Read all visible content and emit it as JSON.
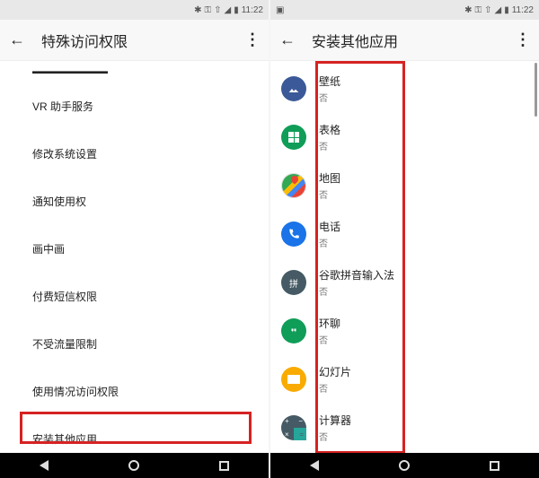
{
  "status": {
    "clock": "11:22"
  },
  "left": {
    "title": "特殊访问权限",
    "items": [
      "VR 助手服务",
      "修改系统设置",
      "通知使用权",
      "画中画",
      "付费短信权限",
      "不受流量限制",
      "使用情况访问权限",
      "安装其他应用"
    ]
  },
  "right": {
    "title": "安装其他应用",
    "deny_label": "否",
    "apps": [
      {
        "name": "壁纸",
        "icon": "photos"
      },
      {
        "name": "表格",
        "icon": "sheets"
      },
      {
        "name": "地图",
        "icon": "maps"
      },
      {
        "name": "电话",
        "icon": "phone"
      },
      {
        "name": "谷歌拼音输入法",
        "icon": "pinyin"
      },
      {
        "name": "环聊",
        "icon": "hangouts"
      },
      {
        "name": "幻灯片",
        "icon": "slides"
      },
      {
        "name": "计算器",
        "icon": "calc"
      }
    ]
  }
}
